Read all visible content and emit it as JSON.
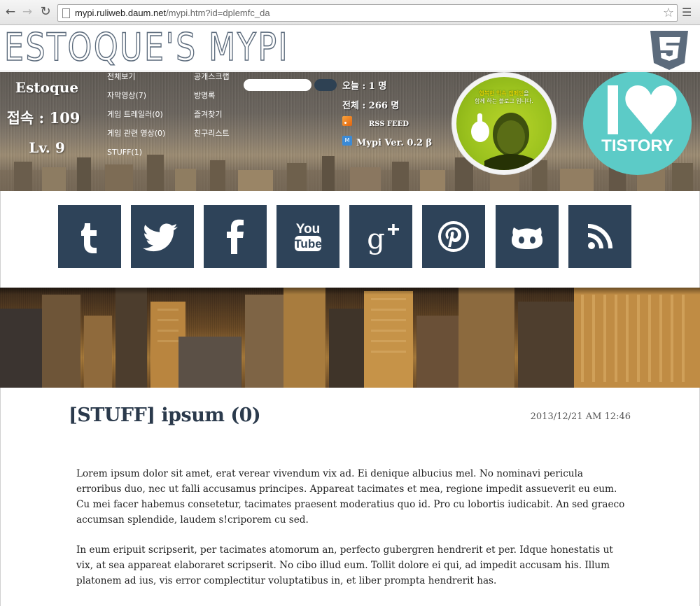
{
  "browser": {
    "url_host": "mypi.ruliweb.daum.net",
    "url_path": "/mypi.htm?id=dplemfc_da"
  },
  "site": {
    "title": "ESTOQUE'S MYPI",
    "css3_icon": "css3-shield-icon"
  },
  "profile": {
    "name": "Estoque",
    "visits": "접속 : 109",
    "level": "Lv. 9"
  },
  "menu": {
    "col1": [
      "전체보기",
      "자막영상(7)",
      "게임 트레일러(0)",
      "게임 관련 영상(0)",
      "STUFF(1)"
    ],
    "col2": [
      "공개스크랩",
      "방명록",
      "즐겨찾기",
      "친구리스트"
    ]
  },
  "stats": {
    "today": "오늘 : 1 명",
    "total": "전체 : 266 명",
    "rss_label": "RSS FEED",
    "mypi_icon_letter": "M",
    "mypi_version": "Mypi Ver. 0.2 β"
  },
  "avatar": {
    "caption_highlight": "행복한 악속 캠페인",
    "caption_line1_suffix": "을",
    "caption_line2": "함께 하는 블로그 입니다."
  },
  "tistory": {
    "label": "TISTORY"
  },
  "social": [
    {
      "name": "tumblr-icon"
    },
    {
      "name": "twitter-icon"
    },
    {
      "name": "facebook-icon"
    },
    {
      "name": "youtube-icon"
    },
    {
      "name": "google-plus-icon"
    },
    {
      "name": "pinterest-icon"
    },
    {
      "name": "github-icon"
    },
    {
      "name": "rss-icon"
    }
  ],
  "post": {
    "title": "[STUFF] ipsum (0)",
    "date": "2013/12/21 AM 12:46",
    "paragraphs": [
      "Lorem ipsum dolor sit amet, erat verear vivendum vix ad. Ei denique albucius mel. No nominavi pericula erroribus duo, nec ut falli accusamus principes. Appareat tacimates et mea, regione impedit assueverit eu eum. Cu mei facer habemus consetetur, tacimates praesent moderatius quo id. Pro cu lobortis iudicabit. An sed graeco accumsan splendide, laudem s!criporem cu sed.",
      "In eum eripuit scripserit, per tacimates atomorum an, perfecto gubergren hendrerit et per. Idque honestatis ut vix, at sea appareat elaboraret scripserit. No cibo illud eum. Tollit dolore ei qui, ad impedit accusam his. Illum platonem ad ius, vis error complectitur voluptatibus in, et liber prompta hendrerit has."
    ]
  },
  "colors": {
    "social_button": "#2e4359",
    "tistory": "#5ccbc7",
    "title_text": "#2b3a4c"
  }
}
